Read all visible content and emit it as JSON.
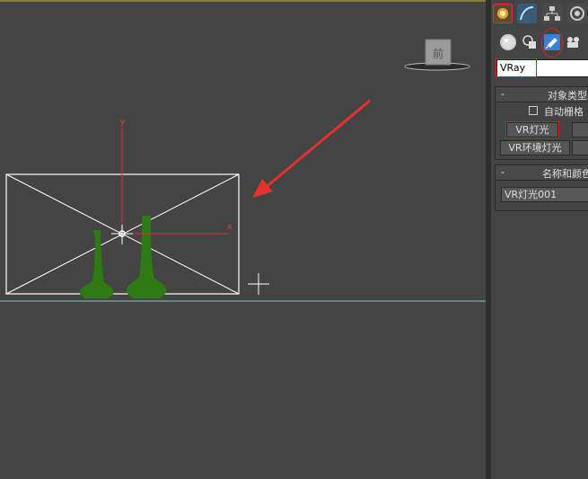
{
  "viewport": {
    "viewcube_label": "前",
    "gizmo": {
      "x_label": "x",
      "y_label": "y"
    }
  },
  "command_panel": {
    "top_tabs": [
      {
        "icon": "create-icon",
        "selected": true
      },
      {
        "icon": "modify-icon"
      },
      {
        "icon": "hierarchy-icon"
      },
      {
        "icon": "motion-icon"
      }
    ],
    "sub_tabs": [
      {
        "icon": "geometry-icon"
      },
      {
        "icon": "shapes-icon"
      },
      {
        "icon": "lights-icon",
        "selected": true
      },
      {
        "icon": "cameras-icon"
      }
    ],
    "category_dropdown": {
      "value": "VRay"
    },
    "object_type": {
      "title": "对象类型",
      "collapse": "-",
      "autogrid_label": "自动栅格",
      "autogrid_checked": false,
      "buttons": [
        "VR灯光",
        "VR环境灯光"
      ]
    },
    "name_color": {
      "title": "名称和颜色",
      "collapse": "-",
      "name_value": "VR灯光001"
    }
  },
  "colors": {
    "accent_red": "#e02020",
    "ground_line": "#7fc8c0",
    "vase_green": "#2f7a12",
    "selected_tab_blue": "#3a7fd8"
  }
}
